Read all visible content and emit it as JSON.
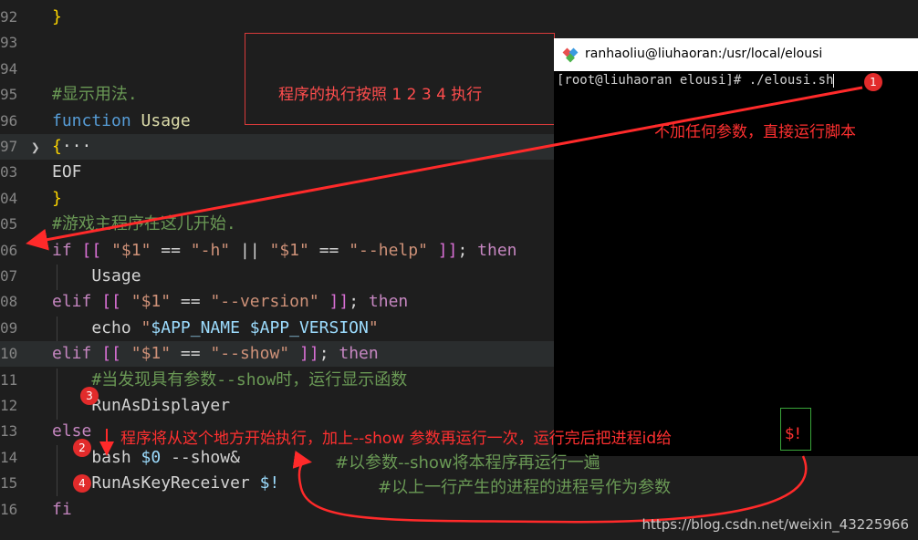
{
  "editor": {
    "lines": [
      {
        "num": "92",
        "parts": [
          {
            "c": "brace",
            "t": "}"
          }
        ]
      },
      {
        "num": "93",
        "parts": []
      },
      {
        "num": "94",
        "parts": []
      },
      {
        "num": "95",
        "parts": [
          {
            "c": "com",
            "t": "#显示用法."
          }
        ]
      },
      {
        "num": "96",
        "parts": [
          {
            "c": "kw",
            "t": "function"
          },
          {
            "c": "plain",
            "t": " "
          },
          {
            "c": "fn",
            "t": "Usage"
          }
        ]
      },
      {
        "num": "97",
        "parts": [
          {
            "c": "brace",
            "t": "{"
          },
          {
            "c": "plain",
            "t": "···"
          }
        ]
      },
      {
        "num": "03",
        "parts": [
          {
            "c": "plain",
            "t": "EOF"
          }
        ]
      },
      {
        "num": "04",
        "parts": [
          {
            "c": "brace",
            "t": "}"
          }
        ]
      },
      {
        "num": "05",
        "parts": [
          {
            "c": "com",
            "t": "#游戏主程序在这儿开始."
          }
        ]
      },
      {
        "num": "06",
        "parts": [
          {
            "c": "kw2",
            "t": "if"
          },
          {
            "c": "plain",
            "t": " "
          },
          {
            "c": "brk",
            "t": "[["
          },
          {
            "c": "plain",
            "t": " "
          },
          {
            "c": "str",
            "t": "\"$1\""
          },
          {
            "c": "plain",
            "t": " == "
          },
          {
            "c": "str",
            "t": "\"-h\""
          },
          {
            "c": "plain",
            "t": " || "
          },
          {
            "c": "str",
            "t": "\"$1\""
          },
          {
            "c": "plain",
            "t": " == "
          },
          {
            "c": "str",
            "t": "\"--help\""
          },
          {
            "c": "plain",
            "t": " "
          },
          {
            "c": "brk",
            "t": "]]"
          },
          {
            "c": "plain",
            "t": "; "
          },
          {
            "c": "kw2",
            "t": "then"
          }
        ]
      },
      {
        "num": "07",
        "parts": [
          {
            "c": "plain",
            "t": "    "
          },
          {
            "c": "plain",
            "t": "Usage"
          }
        ]
      },
      {
        "num": "08",
        "parts": [
          {
            "c": "kw2",
            "t": "elif"
          },
          {
            "c": "plain",
            "t": " "
          },
          {
            "c": "brk",
            "t": "[["
          },
          {
            "c": "plain",
            "t": " "
          },
          {
            "c": "str",
            "t": "\"$1\""
          },
          {
            "c": "plain",
            "t": " == "
          },
          {
            "c": "str",
            "t": "\"--version\""
          },
          {
            "c": "plain",
            "t": " "
          },
          {
            "c": "brk",
            "t": "]]"
          },
          {
            "c": "plain",
            "t": "; "
          },
          {
            "c": "kw2",
            "t": "then"
          }
        ]
      },
      {
        "num": "09",
        "parts": [
          {
            "c": "plain",
            "t": "    echo "
          },
          {
            "c": "str",
            "t": "\""
          },
          {
            "c": "var",
            "t": "$APP_NAME"
          },
          {
            "c": "str",
            "t": " "
          },
          {
            "c": "var",
            "t": "$APP_VERSION"
          },
          {
            "c": "str",
            "t": "\""
          }
        ]
      },
      {
        "num": "10",
        "parts": [
          {
            "c": "kw2",
            "t": "elif"
          },
          {
            "c": "plain",
            "t": " "
          },
          {
            "c": "brk",
            "t": "[["
          },
          {
            "c": "plain",
            "t": " "
          },
          {
            "c": "str",
            "t": "\"$1\""
          },
          {
            "c": "plain",
            "t": " == "
          },
          {
            "c": "str",
            "t": "\"--show\""
          },
          {
            "c": "plain",
            "t": " "
          },
          {
            "c": "brk",
            "t": "]]"
          },
          {
            "c": "plain",
            "t": "; "
          },
          {
            "c": "kw2",
            "t": "then"
          }
        ]
      },
      {
        "num": "11",
        "parts": [
          {
            "c": "plain",
            "t": "    "
          },
          {
            "c": "com",
            "t": "#当发现具有参数--show时，运行显示函数"
          }
        ]
      },
      {
        "num": "12",
        "parts": [
          {
            "c": "plain",
            "t": "    RunAsDisplayer"
          }
        ]
      },
      {
        "num": "13",
        "parts": [
          {
            "c": "kw2",
            "t": "else"
          }
        ]
      },
      {
        "num": "14",
        "parts": [
          {
            "c": "plain",
            "t": "    bash "
          },
          {
            "c": "var",
            "t": "$0"
          },
          {
            "c": "plain",
            "t": " --show&"
          }
        ]
      },
      {
        "num": "15",
        "parts": [
          {
            "c": "plain",
            "t": "    RunAsKeyReceiver "
          },
          {
            "c": "var",
            "t": "$!"
          }
        ]
      },
      {
        "num": "16",
        "parts": [
          {
            "c": "kw2",
            "t": "fi"
          }
        ]
      }
    ]
  },
  "terminal": {
    "title": "ranhaoliu@liuhaoran:/usr/local/elousi",
    "prompt": "[root@liuhaoran elousi]# ./elousi.sh"
  },
  "annotations": {
    "box_note": "程序的执行按照 1 2 3 4 执行",
    "no_args_note": "不加任何参数，直接运行脚本",
    "start_note": "程序将从这个地方开始执行，加上--show 参数再运行一次，运行完后把进程id给",
    "pid_var": "$!",
    "rerun_note": "#以参数--show将本程序再运行一遍",
    "pid_param_note": "#以上一行产生的进程的进程号作为参数",
    "badges": [
      "1",
      "2",
      "3",
      "4"
    ]
  },
  "watermark": "https://blog.csdn.net/weixin_43225966",
  "colors": {
    "annotation_red": "#ff3030",
    "comment_green": "#6a9955",
    "keyword_blue": "#569cd6"
  }
}
